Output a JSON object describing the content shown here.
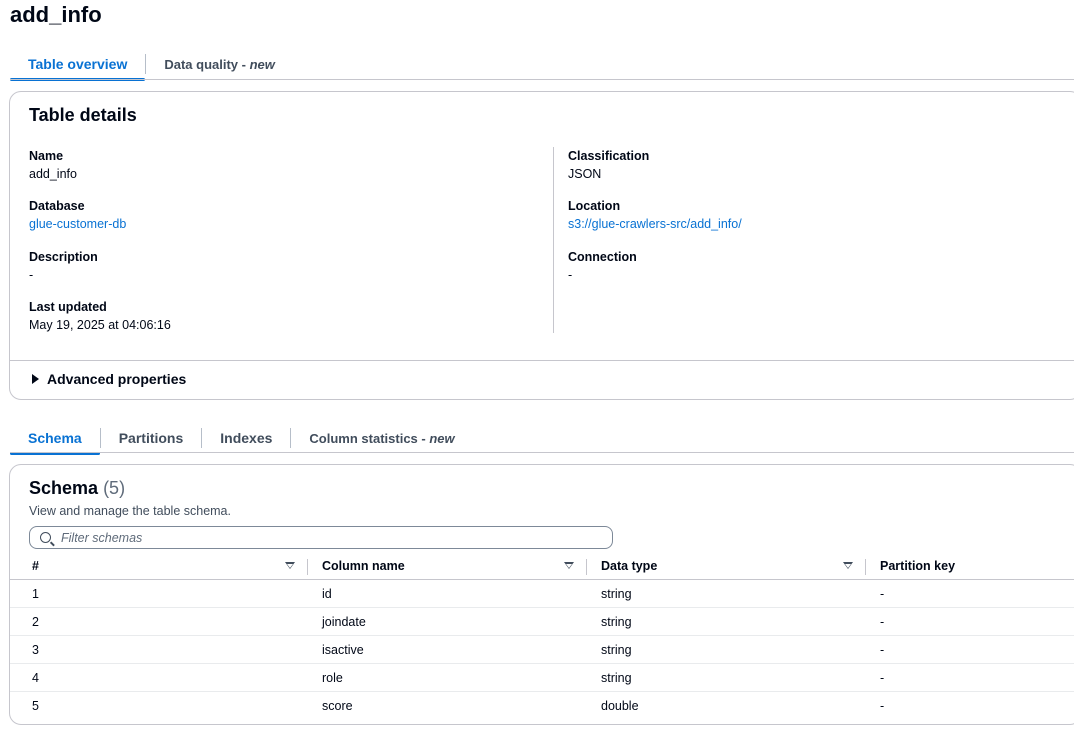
{
  "page": {
    "title": "add_info"
  },
  "top_tabs": [
    {
      "label": "Table overview",
      "suffix": "",
      "active": true
    },
    {
      "label": "Data quality - ",
      "suffix": "new",
      "active": false
    }
  ],
  "details": {
    "heading": "Table details",
    "name_label": "Name",
    "name_value": "add_info",
    "database_label": "Database",
    "database_value": "glue-customer-db",
    "description_label": "Description",
    "description_value": "-",
    "last_updated_label": "Last updated",
    "last_updated_value": "May 19, 2025 at 04:06:16",
    "classification_label": "Classification",
    "classification_value": "JSON",
    "location_label": "Location",
    "location_value": "s3://glue-crawlers-src/add_info/",
    "connection_label": "Connection",
    "connection_value": "-",
    "advanced_label": "Advanced properties"
  },
  "lower_tabs": [
    {
      "label": "Schema",
      "suffix": "",
      "active": true
    },
    {
      "label": "Partitions",
      "suffix": "",
      "active": false
    },
    {
      "label": "Indexes",
      "suffix": "",
      "active": false
    },
    {
      "label": "Column statistics - ",
      "suffix": "new",
      "active": false
    }
  ],
  "schema": {
    "title": "Schema",
    "count": "(5)",
    "description": "View and manage the table schema.",
    "filter_placeholder": "Filter schemas",
    "columns": [
      "#",
      "Column name",
      "Data type",
      "Partition key"
    ],
    "rows": [
      [
        "1",
        "id",
        "string",
        "-"
      ],
      [
        "2",
        "joindate",
        "string",
        "-"
      ],
      [
        "3",
        "isactive",
        "string",
        "-"
      ],
      [
        "4",
        "role",
        "string",
        "-"
      ],
      [
        "5",
        "score",
        "double",
        "-"
      ]
    ]
  },
  "colors": {
    "accent": "#0972d3",
    "text": "#000716",
    "border": "#c6c6cd"
  }
}
